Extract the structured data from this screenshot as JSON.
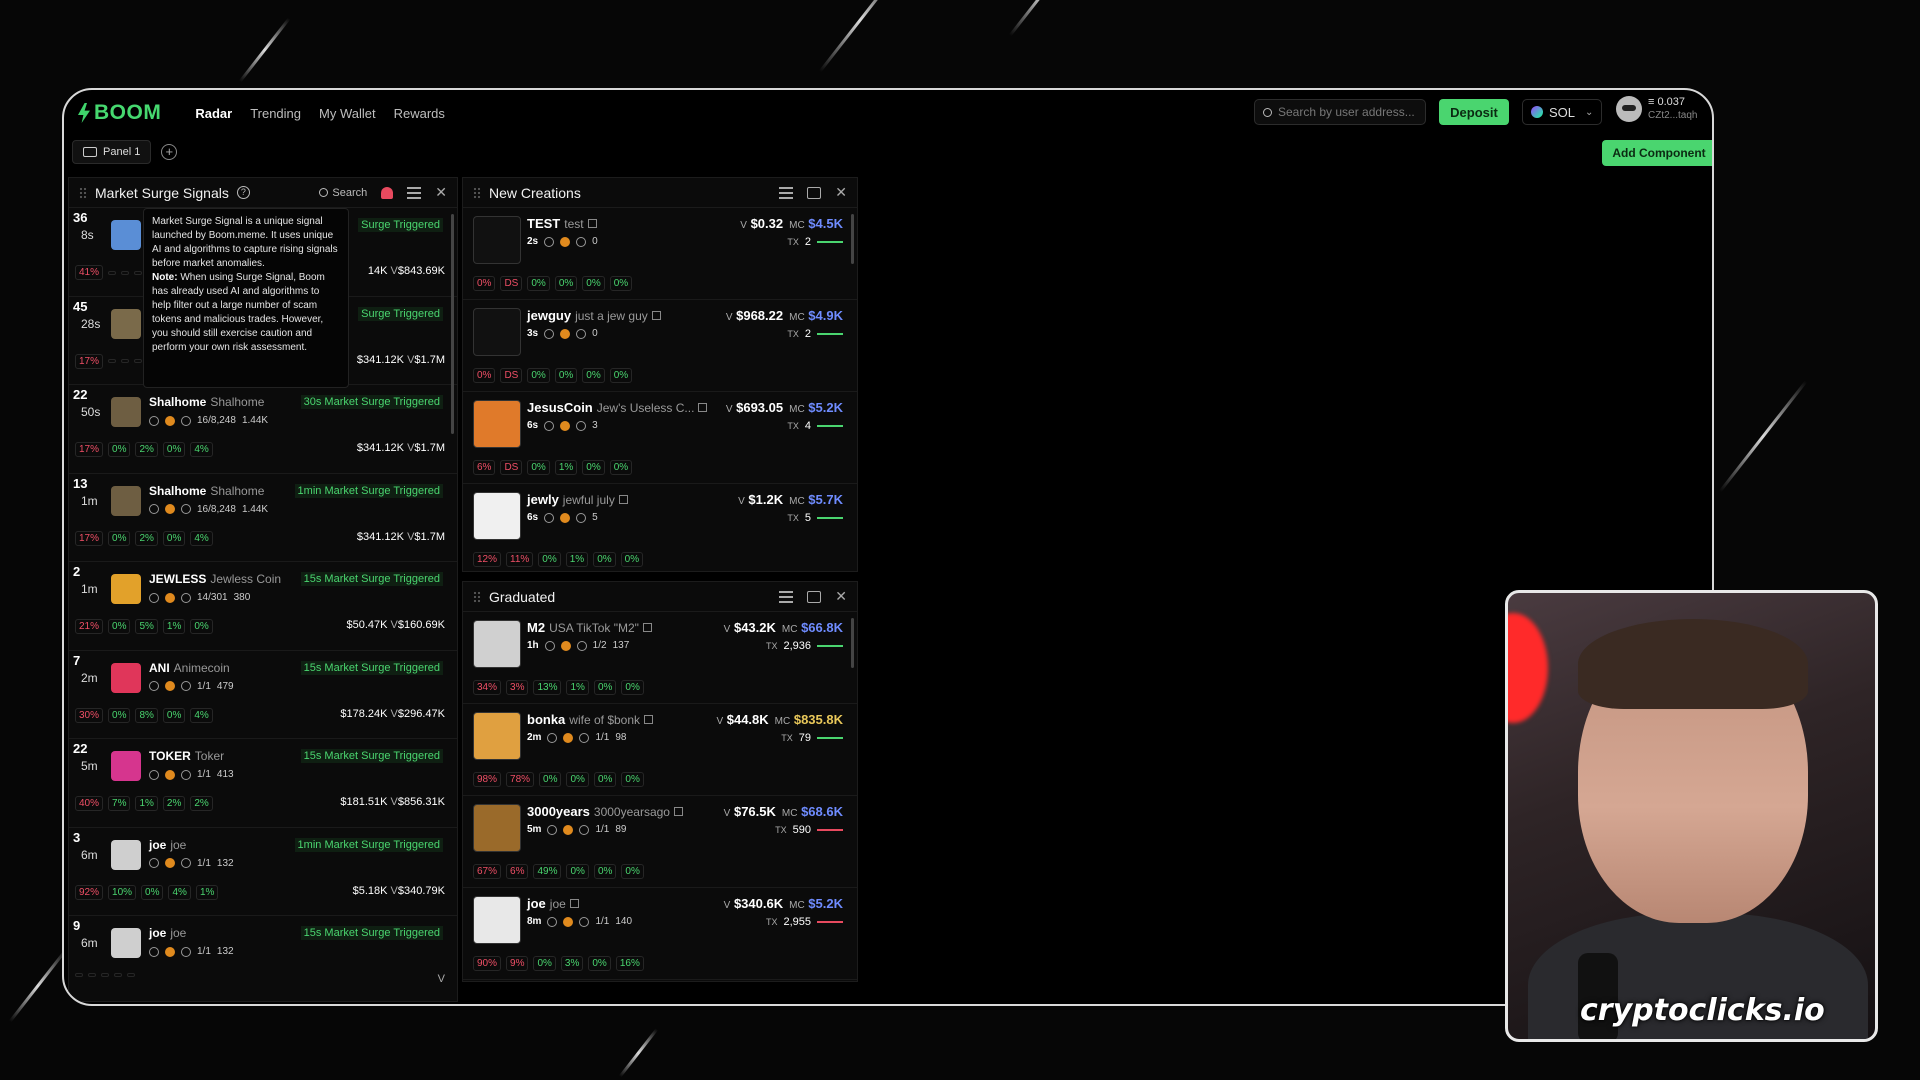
{
  "app": {
    "logo": "BOOM"
  },
  "nav": [
    "Radar",
    "Trending",
    "My Wallet",
    "Rewards"
  ],
  "topbar": {
    "search_placeholder": "Search by user address...",
    "deposit": "Deposit",
    "chain": "SOL",
    "balance": "≡ 0.037",
    "address": "CZt2...taqh"
  },
  "subbar": {
    "panel_tab": "Panel 1",
    "add_component": "Add Component"
  },
  "surge": {
    "title": "Market Surge Signals",
    "search": "Search",
    "tooltip": {
      "p1": "Market Surge Signal is a unique signal launched by Boom.meme. It uses unique AI and algorithms to capture rising signals before market anomalies.",
      "note_label": "Note:",
      "p2": "When using Surge Signal, Boom has already used AI and algorithms to help filter out a large number of scam tokens and malicious trades. However, you should still exercise caution and perform your own risk assessment."
    },
    "rows": [
      {
        "num": "36",
        "age": "8s",
        "name": "",
        "full": "",
        "badge": "Surge Triggered",
        "meta": "",
        "s1": "41%",
        "s2": "",
        "s3": "",
        "s4": "",
        "s5": "",
        "mc": "14K",
        "v": "$843.69K",
        "thumb": "#5a8ed6"
      },
      {
        "num": "45",
        "age": "28s",
        "name": "",
        "full": "",
        "badge": "Surge Triggered",
        "meta": "",
        "s1": "17%",
        "s2": "",
        "s3": "",
        "s4": "",
        "s5": "",
        "mc": "$341.12K",
        "v": "$1.7M",
        "thumb": "#7a6a4a"
      },
      {
        "num": "22",
        "age": "50s",
        "name": "Shalhome",
        "full": "Shalhome",
        "badge": "30s Market Surge Triggered",
        "meta": "16/8,248",
        "holders": "1.44K",
        "s1": "17%",
        "s2": "0%",
        "s3": "2%",
        "s4": "0%",
        "s5": "4%",
        "mc": "$341.12K",
        "v": "$1.7M",
        "thumb": "#6e5e42"
      },
      {
        "num": "13",
        "age": "1m",
        "name": "Shalhome",
        "full": "Shalhome",
        "badge": "1min Market Surge Triggered",
        "meta": "16/8,248",
        "holders": "1.44K",
        "s1": "17%",
        "s2": "0%",
        "s3": "2%",
        "s4": "0%",
        "s5": "4%",
        "mc": "$341.12K",
        "v": "$1.7M",
        "thumb": "#6e5e42"
      },
      {
        "num": "2",
        "age": "1m",
        "name": "JEWLESS",
        "full": "Jewless Coin",
        "badge": "15s Market Surge Triggered",
        "meta": "14/301",
        "holders": "380",
        "s1": "21%",
        "s2": "0%",
        "s3": "5%",
        "s4": "1%",
        "s5": "0%",
        "mc": "$50.47K",
        "v": "$160.69K",
        "thumb": "#e2a12a"
      },
      {
        "num": "7",
        "age": "2m",
        "name": "ANI",
        "full": "Animecoin",
        "badge": "15s Market Surge Triggered",
        "meta": "1/1",
        "holders": "479",
        "s1": "30%",
        "s2": "0%",
        "s3": "8%",
        "s4": "0%",
        "s5": "4%",
        "mc": "$178.24K",
        "v": "$296.47K",
        "thumb": "#e0365a"
      },
      {
        "num": "22",
        "age": "5m",
        "name": "TOKER",
        "full": "Toker",
        "badge": "15s Market Surge Triggered",
        "meta": "1/1",
        "holders": "413",
        "s1": "40%",
        "s2": "7%",
        "s3": "1%",
        "s4": "2%",
        "s5": "2%",
        "mc": "$181.51K",
        "v": "$856.31K",
        "thumb": "#d6358e"
      },
      {
        "num": "3",
        "age": "6m",
        "name": "joe",
        "full": "joe",
        "badge": "1min Market Surge Triggered",
        "meta": "1/1",
        "holders": "132",
        "s1": "92%",
        "s2": "10%",
        "s3": "0%",
        "s4": "4%",
        "s5": "1%",
        "mc": "$5.18K",
        "v": "$340.79K",
        "thumb": "#cfcfcf"
      },
      {
        "num": "9",
        "age": "6m",
        "name": "joe",
        "full": "joe",
        "badge": "15s Market Surge Triggered",
        "meta": "1/1",
        "holders": "132",
        "s1": "",
        "s2": "",
        "s3": "",
        "s4": "",
        "s5": "",
        "mc": "",
        "v": "",
        "thumb": "#cfcfcf"
      }
    ]
  },
  "new_creations": {
    "title": "New Creations",
    "rows": [
      {
        "name": "TEST",
        "full": "test",
        "age": "2s",
        "extra": "0",
        "v": "$0.32",
        "mc": "$4.5K",
        "tx": "2",
        "s": [
          "0%",
          "DS",
          "0%",
          "0%",
          "0%",
          "0%"
        ],
        "thumb": "#111"
      },
      {
        "name": "jewguy",
        "full": "just a jew guy",
        "age": "3s",
        "extra": "0",
        "v": "$968.22",
        "mc": "$4.9K",
        "tx": "2",
        "s": [
          "0%",
          "DS",
          "0%",
          "0%",
          "0%",
          "0%"
        ],
        "thumb": "#111"
      },
      {
        "name": "JesusCoin",
        "full": "Jew's Useless C...",
        "age": "6s",
        "extra": "3",
        "v": "$693.05",
        "mc": "$5.2K",
        "tx": "4",
        "s": [
          "6%",
          "DS",
          "0%",
          "1%",
          "0%",
          "0%"
        ],
        "thumb": "#e07a2a"
      },
      {
        "name": "jewly",
        "full": "jewful july",
        "age": "6s",
        "extra": "5",
        "v": "$1.2K",
        "mc": "$5.7K",
        "tx": "5",
        "s": [
          "12%",
          "11%",
          "0%",
          "1%",
          "0%",
          "0%"
        ],
        "thumb": "#f0f0f0"
      }
    ]
  },
  "graduated": {
    "title": "Graduated",
    "rows": [
      {
        "name": "M2",
        "full": "USA TikTok \"M2\"",
        "age": "1h",
        "holders": "1/2",
        "extra": "137",
        "v": "$43.2K",
        "mc": "$66.8K",
        "tx": "2,936",
        "s": [
          "34%",
          "3%",
          "13%",
          "1%",
          "0%",
          "0%"
        ],
        "thumb": "#d0d0d0",
        "mcy": false,
        "barred": true
      },
      {
        "name": "bonka",
        "full": "wife of $bonk",
        "age": "2m",
        "holders": "1/1",
        "extra": "98",
        "v": "$44.8K",
        "mc": "$835.8K",
        "tx": "79",
        "s": [
          "98%",
          "78%",
          "0%",
          "0%",
          "0%",
          "0%"
        ],
        "thumb": "#e0a040",
        "mcy": true,
        "barred": false
      },
      {
        "name": "3000years",
        "full": "3000yearsago",
        "age": "5m",
        "holders": "1/1",
        "extra": "89",
        "v": "$76.5K",
        "mc": "$68.6K",
        "tx": "590",
        "s": [
          "67%",
          "6%",
          "49%",
          "0%",
          "0%",
          "0%"
        ],
        "thumb": "#9a6a2a",
        "mcy": false,
        "barred": true
      },
      {
        "name": "joe",
        "full": "joe",
        "age": "8m",
        "holders": "1/1",
        "extra": "140",
        "v": "$340.6K",
        "mc": "$5.2K",
        "tx": "2,955",
        "s": [
          "90%",
          "9%",
          "0%",
          "3%",
          "0%",
          "16%"
        ],
        "thumb": "#e8e8e8",
        "mcy": false,
        "barred": true
      }
    ]
  },
  "webcam": {
    "label": "cryptoclicks.io"
  },
  "labels": {
    "v": "V",
    "mc": "MC",
    "tx": "TX"
  },
  "colors": {
    "accent": "#4ad56f",
    "danger": "#e84a5f",
    "mc_blue": "#6f8cff",
    "mc_gold": "#e9c85a"
  }
}
